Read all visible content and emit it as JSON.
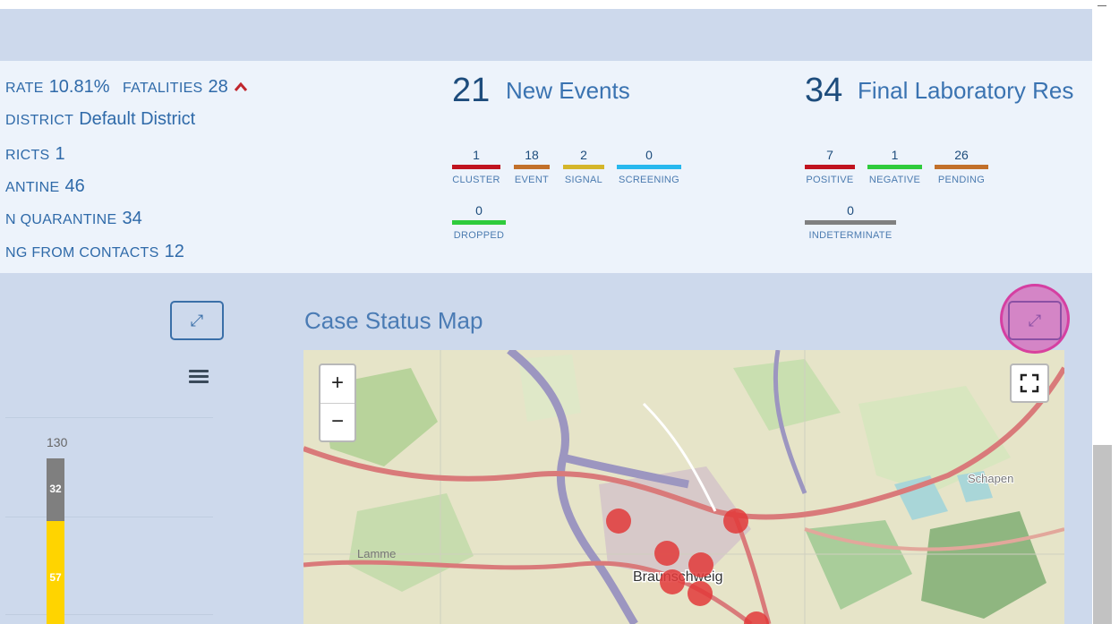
{
  "left_stats": {
    "rate_label": "RATE",
    "rate_value": "10.81%",
    "fatalities_label": "FATALITIES",
    "fatalities_value": "28",
    "district_label": "DISTRICT",
    "district_value": "Default District",
    "districts_label": "RICTS",
    "districts_value": "1",
    "quarantine_label": "ANTINE",
    "quarantine_value": "46",
    "in_quarantine_label": "N QUARANTINE",
    "in_quarantine_value": "34",
    "from_contacts_label": "NG FROM CONTACTS",
    "from_contacts_value": "12",
    "fatalities_trend_icon": "chevron-up-icon"
  },
  "events": {
    "count": "21",
    "title": "New Events",
    "items": [
      {
        "value": "1",
        "label": "CLUSTER",
        "color": "#c0131f"
      },
      {
        "value": "18",
        "label": "EVENT",
        "color": "#c2702a"
      },
      {
        "value": "2",
        "label": "SIGNAL",
        "color": "#d4b62a"
      },
      {
        "value": "0",
        "label": "SCREENING",
        "color": "#27b8ee"
      },
      {
        "value": "0",
        "label": "DROPPED",
        "color": "#2fcb3c"
      }
    ]
  },
  "lab": {
    "count": "34",
    "title": "Final Laboratory Res",
    "items": [
      {
        "value": "7",
        "label": "POSITIVE",
        "color": "#c0131f"
      },
      {
        "value": "1",
        "label": "NEGATIVE",
        "color": "#2fcb3c"
      },
      {
        "value": "26",
        "label": "PENDING",
        "color": "#c2702a"
      },
      {
        "value": "0",
        "label": "INDETERMINATE",
        "color": "#808080"
      }
    ]
  },
  "chart_panel": {
    "expand_icon": "expand-icon",
    "menu_icon": "hamburger-menu-icon",
    "axis_label": "130",
    "segments": [
      {
        "value": "32",
        "color": "#7f7f7f"
      },
      {
        "value": "57",
        "color": "#ffd400"
      }
    ]
  },
  "map": {
    "title": "Case Status Map",
    "zoom_in": "+",
    "zoom_out": "−",
    "fullscreen_icon": "fullscreen-icon",
    "expand_icon": "expand-icon",
    "places": [
      "Lamme",
      "Braunschweig",
      "Schapen"
    ]
  }
}
